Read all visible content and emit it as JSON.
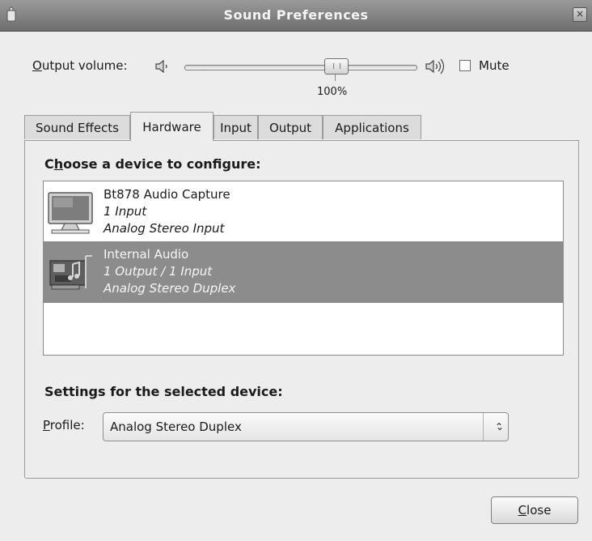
{
  "window": {
    "title": "Sound Preferences",
    "close_glyph": "×"
  },
  "volume": {
    "label_accel": "O",
    "label_rest": "utput volume:",
    "value_percent": 100,
    "value_label": "100%",
    "mute_label": "Mute",
    "mute_checked": false
  },
  "tabs": [
    {
      "label": "Sound Effects",
      "active": false
    },
    {
      "label": "Hardware",
      "active": true
    },
    {
      "label": "Input",
      "active": false
    },
    {
      "label": "Output",
      "active": false
    },
    {
      "label": "Applications",
      "active": false
    }
  ],
  "hardware": {
    "choose_heading_pre": "C",
    "choose_heading_accel": "h",
    "choose_heading_rest": "oose a device to configure:",
    "devices": [
      {
        "name": "Bt878 Audio Capture",
        "io": "1 Input",
        "profile": "Analog Stereo Input",
        "icon": "monitor-icon",
        "selected": false
      },
      {
        "name": "Internal Audio",
        "io": "1 Output / 1 Input",
        "profile": "Analog Stereo Duplex",
        "icon": "sound-card-icon",
        "selected": true
      }
    ],
    "settings_heading": "Settings for the selected device:",
    "profile_label_accel": "P",
    "profile_label_rest": "rofile:",
    "profile_value": "Analog Stereo Duplex"
  },
  "buttons": {
    "close_accel": "C",
    "close_rest": "lose"
  },
  "colors": {
    "selected_row": "#8c8c8c",
    "titlebar": "#7e7e7e"
  }
}
